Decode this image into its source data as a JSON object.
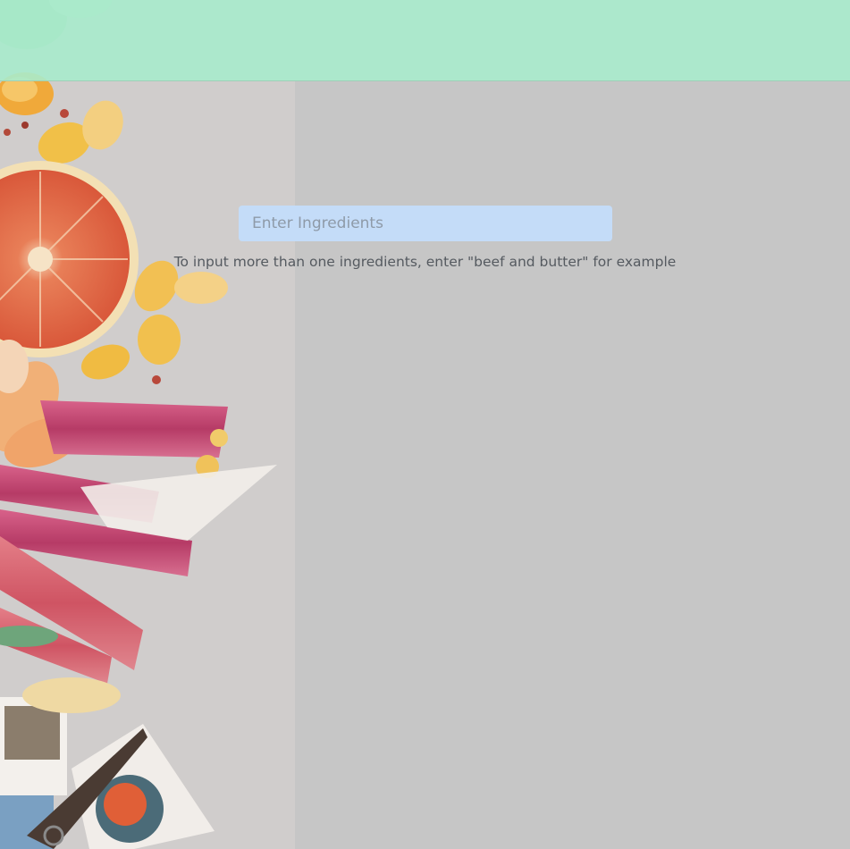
{
  "search": {
    "placeholder": "Enter Ingredients",
    "value": ""
  },
  "hint": "To input more than one ingredients, enter \"beef and butter\" for example",
  "colors": {
    "topbar": "#a8ebcc",
    "input_bg": "#c4dcf8",
    "page_bg": "#c6c6c6"
  },
  "background_image": "food-flatlay-photo"
}
